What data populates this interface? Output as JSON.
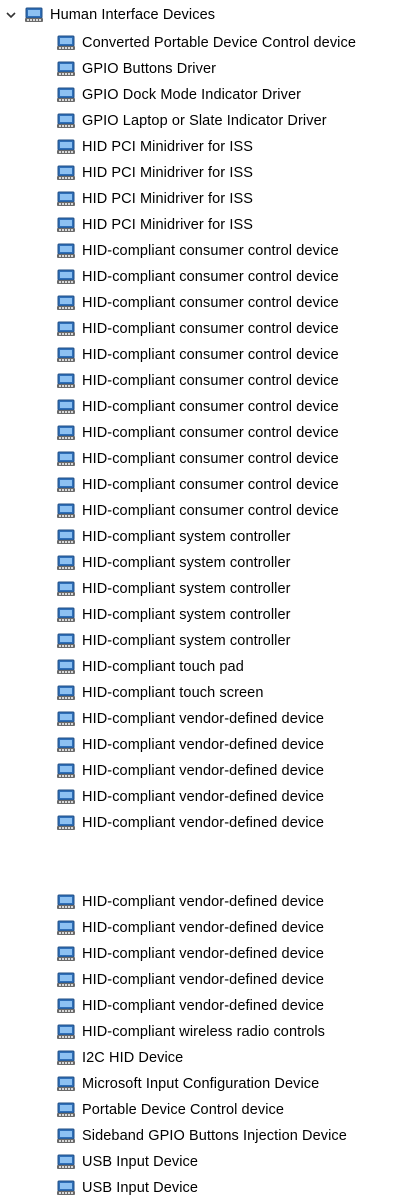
{
  "tree": {
    "category": {
      "label": "Human Interface Devices",
      "expanded": true,
      "icon": "hid-device-icon",
      "chevron_icon": "chevron-down-icon"
    },
    "devices_top": [
      {
        "label": "Converted Portable Device Control device"
      },
      {
        "label": "GPIO Buttons Driver"
      },
      {
        "label": "GPIO Dock Mode Indicator Driver"
      },
      {
        "label": "GPIO Laptop or Slate Indicator Driver"
      },
      {
        "label": "HID PCI Minidriver for ISS"
      },
      {
        "label": "HID PCI Minidriver for ISS"
      },
      {
        "label": "HID PCI Minidriver for ISS"
      },
      {
        "label": "HID PCI Minidriver for ISS"
      },
      {
        "label": "HID-compliant consumer control device"
      },
      {
        "label": "HID-compliant consumer control device"
      },
      {
        "label": "HID-compliant consumer control device"
      },
      {
        "label": "HID-compliant consumer control device"
      },
      {
        "label": "HID-compliant consumer control device"
      },
      {
        "label": "HID-compliant consumer control device"
      },
      {
        "label": "HID-compliant consumer control device"
      },
      {
        "label": "HID-compliant consumer control device"
      },
      {
        "label": "HID-compliant consumer control device"
      },
      {
        "label": "HID-compliant consumer control device"
      },
      {
        "label": "HID-compliant consumer control device"
      },
      {
        "label": "HID-compliant system controller"
      },
      {
        "label": "HID-compliant system controller"
      },
      {
        "label": "HID-compliant system controller"
      },
      {
        "label": "HID-compliant system controller"
      },
      {
        "label": "HID-compliant system controller"
      },
      {
        "label": "HID-compliant touch pad"
      },
      {
        "label": "HID-compliant touch screen"
      },
      {
        "label": "HID-compliant vendor-defined device"
      },
      {
        "label": "HID-compliant vendor-defined device"
      },
      {
        "label": "HID-compliant vendor-defined device"
      },
      {
        "label": "HID-compliant vendor-defined device"
      },
      {
        "label": "HID-compliant vendor-defined device"
      }
    ],
    "devices_bottom": [
      {
        "label": "HID-compliant vendor-defined device"
      },
      {
        "label": "HID-compliant vendor-defined device"
      },
      {
        "label": "HID-compliant vendor-defined device"
      },
      {
        "label": "HID-compliant vendor-defined device"
      },
      {
        "label": "HID-compliant vendor-defined device"
      },
      {
        "label": "HID-compliant wireless radio controls"
      },
      {
        "label": "I2C HID Device"
      },
      {
        "label": "Microsoft Input Configuration Device"
      },
      {
        "label": "Portable Device Control device"
      },
      {
        "label": "Sideband GPIO Buttons Injection Device"
      },
      {
        "label": "USB Input Device"
      },
      {
        "label": "USB Input Device"
      }
    ],
    "device_icon": "hid-device-icon"
  }
}
